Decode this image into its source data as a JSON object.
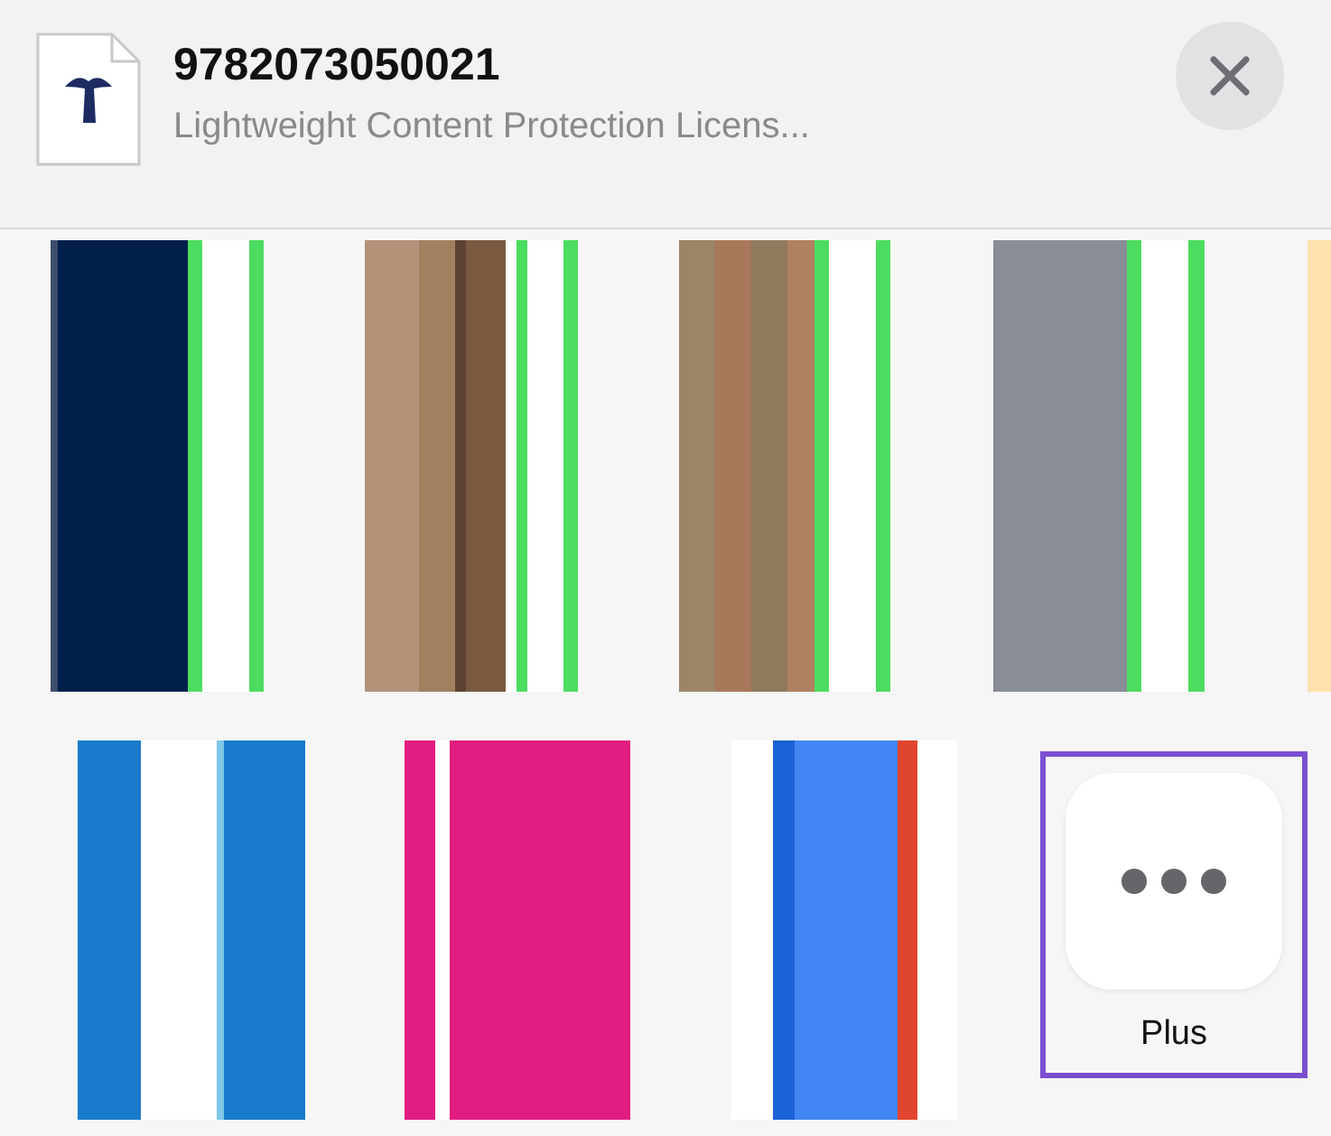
{
  "header": {
    "title": "9782073050021",
    "subtitle": "Lightweight Content Protection Licens..."
  },
  "app_rows": [
    [
      {
        "kind": "stripes"
      },
      {
        "kind": "stripes"
      },
      {
        "kind": "stripes"
      },
      {
        "kind": "stripes"
      },
      {
        "kind": "stripes"
      }
    ],
    [
      {
        "kind": "stripes"
      },
      {
        "kind": "stripes"
      },
      {
        "kind": "stripes"
      },
      {
        "kind": "more",
        "label": "Plus",
        "selected": true
      }
    ]
  ]
}
